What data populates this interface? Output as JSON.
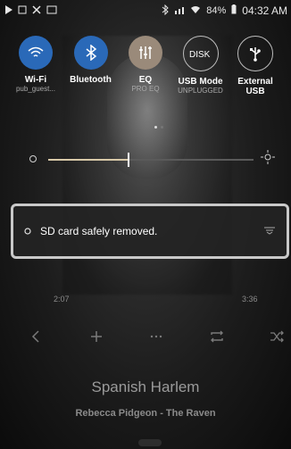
{
  "status": {
    "battery_percent": "84%",
    "time": "04:32 AM",
    "icons": [
      "play-icon",
      "media-icon",
      "no-signal-icon",
      "display-icon",
      "bluetooth-icon",
      "signal-icon",
      "wifi-icon",
      "battery-icon"
    ]
  },
  "quick": {
    "tiles": [
      {
        "id": "wifi",
        "label": "Wi-Fi",
        "sub": "pub_guest..."
      },
      {
        "id": "bluetooth",
        "label": "Bluetooth",
        "sub": ""
      },
      {
        "id": "eq",
        "label": "EQ",
        "sub": "PRO EQ"
      },
      {
        "id": "usb_mode",
        "label": "USB Mode",
        "sub": "UNPLUGGED"
      },
      {
        "id": "external_usb",
        "label": "External USB",
        "sub": ""
      }
    ],
    "brightness_level": 0.39
  },
  "notification": {
    "text": "SD card safely removed."
  },
  "player": {
    "time_elapsed": "2:07",
    "time_total": "3:36",
    "song_title": "Spanish Harlem",
    "artist_album": "Rebecca Pidgeon - The Raven"
  },
  "colors": {
    "accent_blue": "#2a69b8",
    "eq_tile": "#9a8a7a",
    "slider_fill": "#d8c9a8"
  }
}
